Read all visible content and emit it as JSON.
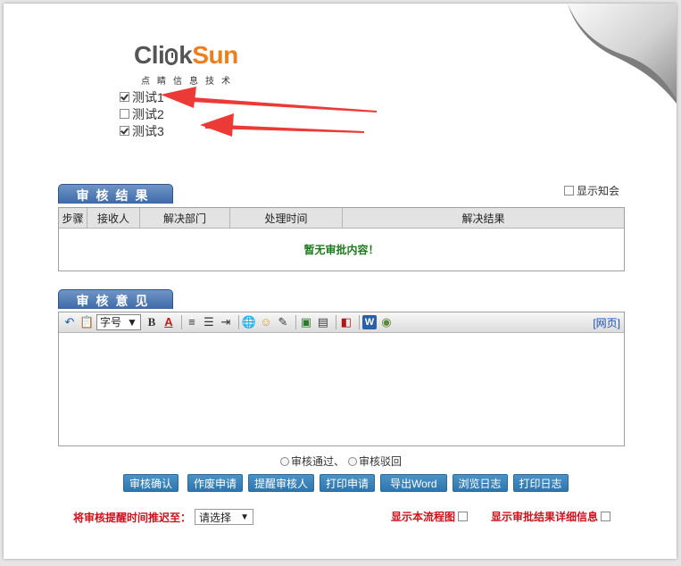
{
  "logo": {
    "brand_left": "Cli",
    "brand_mid": "k",
    "brand_right": "Sun",
    "subtitle": "点睛信息技术"
  },
  "tests": [
    {
      "label": "测试1",
      "checked": true
    },
    {
      "label": "测试2",
      "checked": false
    },
    {
      "label": "测试3",
      "checked": true
    }
  ],
  "result_section": {
    "tab": "审核结果",
    "show_know_label": "显示知会",
    "columns": [
      "步骤",
      "接收人",
      "解决部门",
      "处理时间",
      "解决结果"
    ],
    "empty_text": "暂无审批内容！"
  },
  "opinion_section": {
    "tab": "审核意见",
    "font_select": "字号",
    "webpage_link": "[网页]"
  },
  "radios": {
    "pass": "审核通过、",
    "reject": "审核驳回"
  },
  "buttons": [
    "审核确认",
    "作废申请",
    "提醒审核人",
    "打印申请",
    "导出Word",
    "浏览日志",
    "打印日志"
  ],
  "delay": {
    "label": "将审核提醒时间推迟至：",
    "select_value": "请选择"
  },
  "flow_label": "显示本流程图",
  "detail_label": "显示审批结果详细信息",
  "colors": {
    "tab_blue": "#3d6aa8",
    "button_blue": "#2e76ad",
    "alert_red": "#d0111b",
    "empty_green": "#1c7a1c",
    "logo_orange": "#f07d1c"
  }
}
